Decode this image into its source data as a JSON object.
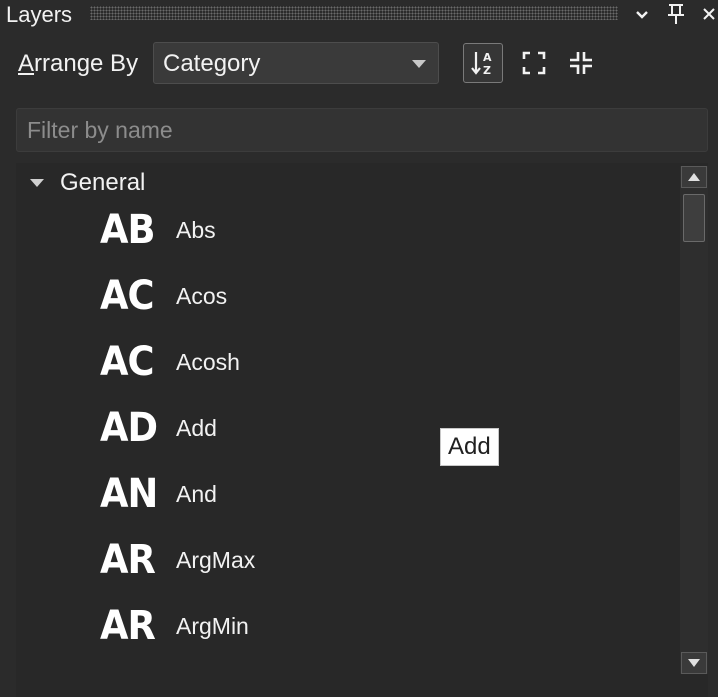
{
  "panel": {
    "title": "Layers"
  },
  "arrange": {
    "label_first": "A",
    "label_rest": "rrange By",
    "selected": "Category"
  },
  "filter": {
    "placeholder": "Filter by name",
    "value": ""
  },
  "tree": {
    "group": "General",
    "items": [
      {
        "abbr": "AB",
        "name": "Abs"
      },
      {
        "abbr": "AC",
        "name": "Acos"
      },
      {
        "abbr": "AC",
        "name": "Acosh"
      },
      {
        "abbr": "AD",
        "name": "Add"
      },
      {
        "abbr": "AN",
        "name": "And"
      },
      {
        "abbr": "AR",
        "name": "ArgMax"
      },
      {
        "abbr": "AR",
        "name": "ArgMin"
      }
    ]
  },
  "tooltip": {
    "text": "Add"
  },
  "icons": {
    "menu": "chevron-down-icon",
    "pin": "pin-icon",
    "close": "close-icon",
    "sort": "sort-az-icon",
    "expand": "expand-all-icon",
    "collapse": "collapse-all-icon"
  }
}
